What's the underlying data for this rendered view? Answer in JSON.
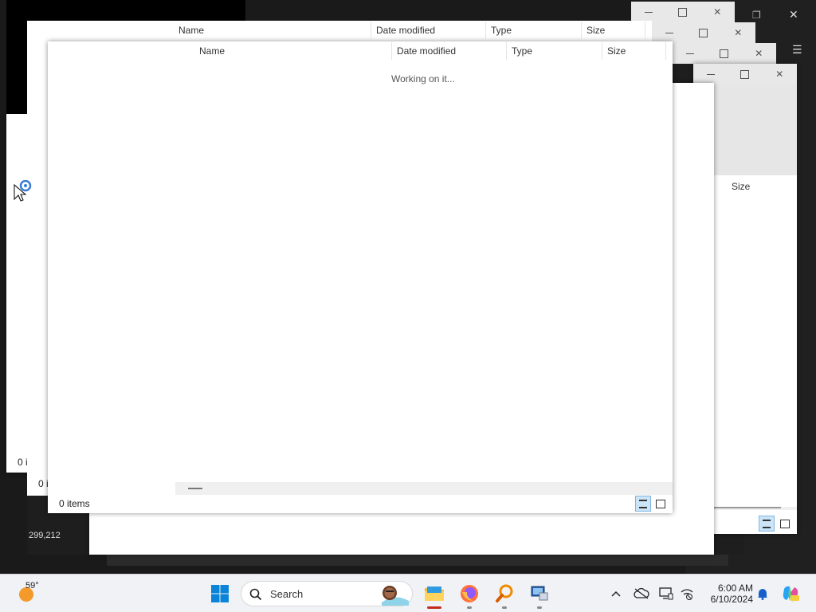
{
  "windows": {
    "columns": {
      "name": "Name",
      "date_modified": "Date modified",
      "type": "Type",
      "size": "Size"
    },
    "loading_text": "Working on it...",
    "status_items": "0 items",
    "status_items_truncated": "0 i",
    "coordinates": "299,212"
  },
  "taskbar": {
    "weather_temp": "59°",
    "search_placeholder": "Search",
    "clock_time": "6:00 AM",
    "clock_date": "6/10/2024"
  },
  "colors": {
    "accent": "#0078d4",
    "taskbar_bg": "#f0f2f5",
    "active_indicator": "#c42b1c"
  }
}
